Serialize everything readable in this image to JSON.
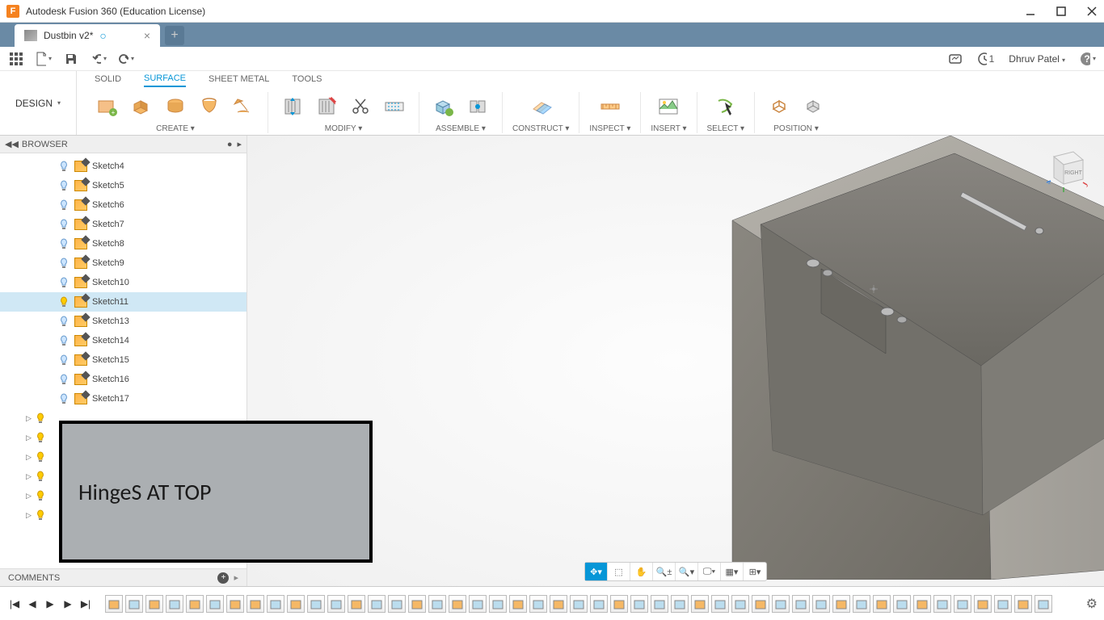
{
  "app": {
    "title": "Autodesk Fusion 360 (Education License)",
    "icon_letter": "F"
  },
  "tab": {
    "name": "Dustbin v2*"
  },
  "quickbar": {
    "jobs_count": "1",
    "user": "Dhruv Patel"
  },
  "workspace_selector": "DESIGN",
  "ribbon_tabs": [
    "SOLID",
    "SURFACE",
    "SHEET METAL",
    "TOOLS"
  ],
  "ribbon_active_tab": "SURFACE",
  "ribbon_groups": [
    "CREATE",
    "MODIFY",
    "ASSEMBLE",
    "CONSTRUCT",
    "INSPECT",
    "INSERT",
    "SELECT",
    "POSITION"
  ],
  "browser": {
    "header": "BROWSER",
    "sketches": [
      {
        "name": "Sketch4",
        "on": false
      },
      {
        "name": "Sketch5",
        "on": false
      },
      {
        "name": "Sketch6",
        "on": false
      },
      {
        "name": "Sketch7",
        "on": false
      },
      {
        "name": "Sketch8",
        "on": false
      },
      {
        "name": "Sketch9",
        "on": false
      },
      {
        "name": "Sketch10",
        "on": false
      },
      {
        "name": "Sketch11",
        "on": true,
        "selected": true
      },
      {
        "name": "Sketch13",
        "on": false
      },
      {
        "name": "Sketch14",
        "on": false
      },
      {
        "name": "Sketch15",
        "on": false
      },
      {
        "name": "Sketch16",
        "on": false
      },
      {
        "name": "Sketch17",
        "on": false
      }
    ]
  },
  "comments_label": "COMMENTS",
  "annotation_text": "HingeS AT TOP",
  "viewcube_face": "RIGHT"
}
